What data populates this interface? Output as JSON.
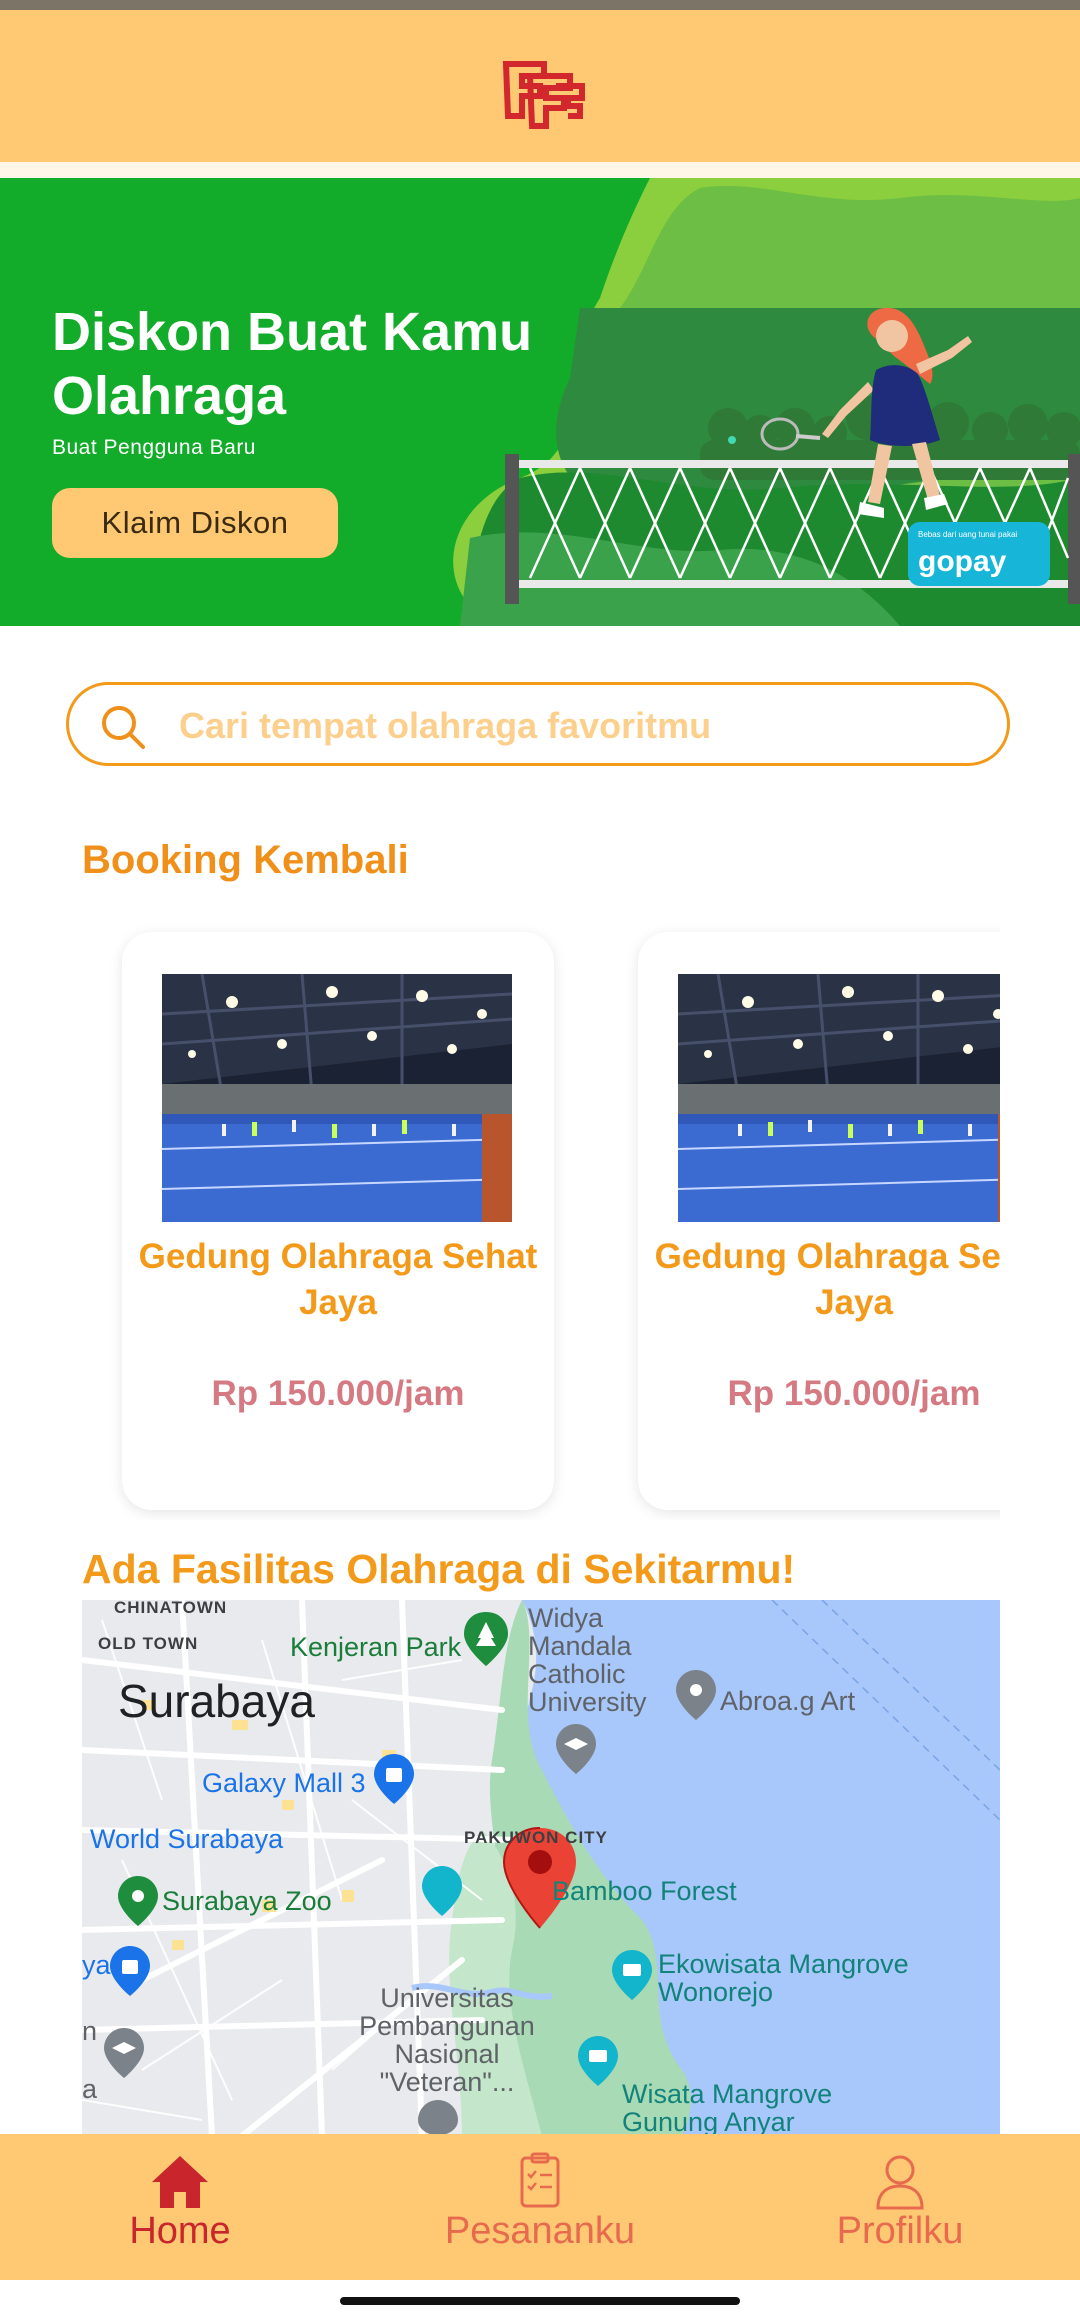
{
  "header": {
    "logo": "app-logo"
  },
  "banner": {
    "title": "Diskon Buat Kamu Olahraga",
    "subtitle": "Buat Pengguna Baru",
    "cta_label": "Klaim Diskon",
    "badge_small": "Bebas dari uang tunai pakai",
    "badge_text": "gopay"
  },
  "search": {
    "placeholder": "Cari tempat olahraga favoritmu",
    "value": ""
  },
  "booking": {
    "title": "Booking Kembali",
    "items": [
      {
        "name": "Gedung Olahraga Sehat Jaya",
        "price": "Rp 150.000/jam"
      },
      {
        "name": "Gedung Olahraga Sehat Jaya",
        "price": "Rp 150.000/jam"
      }
    ]
  },
  "nearby": {
    "title": "Ada Fasilitas Olahraga di Sekitarmu!",
    "map_labels": {
      "chinatown": "CHINATOWN",
      "oldtown": "OLD TOWN",
      "surabaya": "Surabaya",
      "kenjeran": "Kenjeran Park",
      "widya": "Widya Mandala Catholic University",
      "abroag": "Abroa.g Art",
      "galaxy": "Galaxy Mall 3",
      "world": "World Surabaya",
      "pakuwon": "PAKUWON CITY",
      "bamboo": "Bamboo Forest",
      "zoo": "Surabaya Zoo",
      "ekowisata": "Ekowisata Mangrove Wonorejo",
      "upn": "Universitas Pembangunan Nasional \"Veteran\"...",
      "wisata": "Wisata Mangrove Gunung Anyar",
      "edge_ya": "ya",
      "edge_n": "n",
      "edge_a": "a"
    }
  },
  "nav": {
    "items": [
      {
        "label": "Home",
        "icon": "home-icon",
        "active": true
      },
      {
        "label": "Pesananku",
        "icon": "clipboard-icon",
        "active": false
      },
      {
        "label": "Profilku",
        "icon": "user-icon",
        "active": false
      }
    ]
  },
  "colors": {
    "accent": "#f39a1a",
    "header": "#fec972",
    "banner_green": "#13ab2a",
    "price": "#d57a82",
    "nav_active": "#c8262c",
    "nav_inactive": "#e86a4e"
  }
}
